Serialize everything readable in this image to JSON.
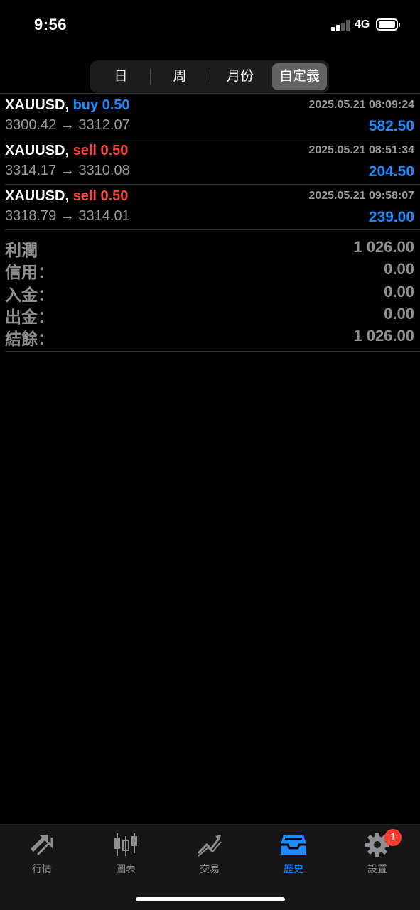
{
  "status": {
    "time": "9:56",
    "network": "4G"
  },
  "period_tabs": [
    {
      "label": "日"
    },
    {
      "label": "周"
    },
    {
      "label": "月份"
    },
    {
      "label": "自定義",
      "selected": true
    }
  ],
  "deals": [
    {
      "symbol": "XAUUSD,",
      "side": "buy",
      "volume": "0.50",
      "datetime": "2025.05.21 08:09:24",
      "prices": "3300.42 → 3312.07",
      "profit": "582.50"
    },
    {
      "symbol": "XAUUSD,",
      "side": "sell",
      "volume": "0.50",
      "datetime": "2025.05.21 08:51:34",
      "prices": "3314.17 → 3310.08",
      "profit": "204.50"
    },
    {
      "symbol": "XAUUSD,",
      "side": "sell",
      "volume": "0.50",
      "datetime": "2025.05.21 09:58:07",
      "prices": "3318.79 → 3314.01",
      "profit": "239.00"
    }
  ],
  "summary": [
    {
      "label": "利潤",
      "value": "1 026.00"
    },
    {
      "label": "信用：",
      "value": "0.00"
    },
    {
      "label": "入金：",
      "value": "0.00"
    },
    {
      "label": "出金：",
      "value": "0.00"
    },
    {
      "label": "結餘：",
      "value": "1 026.00"
    }
  ],
  "tabbar": [
    {
      "label": "行情",
      "icon": "quotes-icon"
    },
    {
      "label": "圖表",
      "icon": "chart-icon"
    },
    {
      "label": "交易",
      "icon": "trade-icon"
    },
    {
      "label": "歷史",
      "icon": "history-icon",
      "active": true
    },
    {
      "label": "設置",
      "icon": "settings-icon",
      "badge": "1"
    }
  ],
  "colors": {
    "accent": "#1a8cff",
    "sell": "#ff453a",
    "badge": "#ff3b30"
  }
}
